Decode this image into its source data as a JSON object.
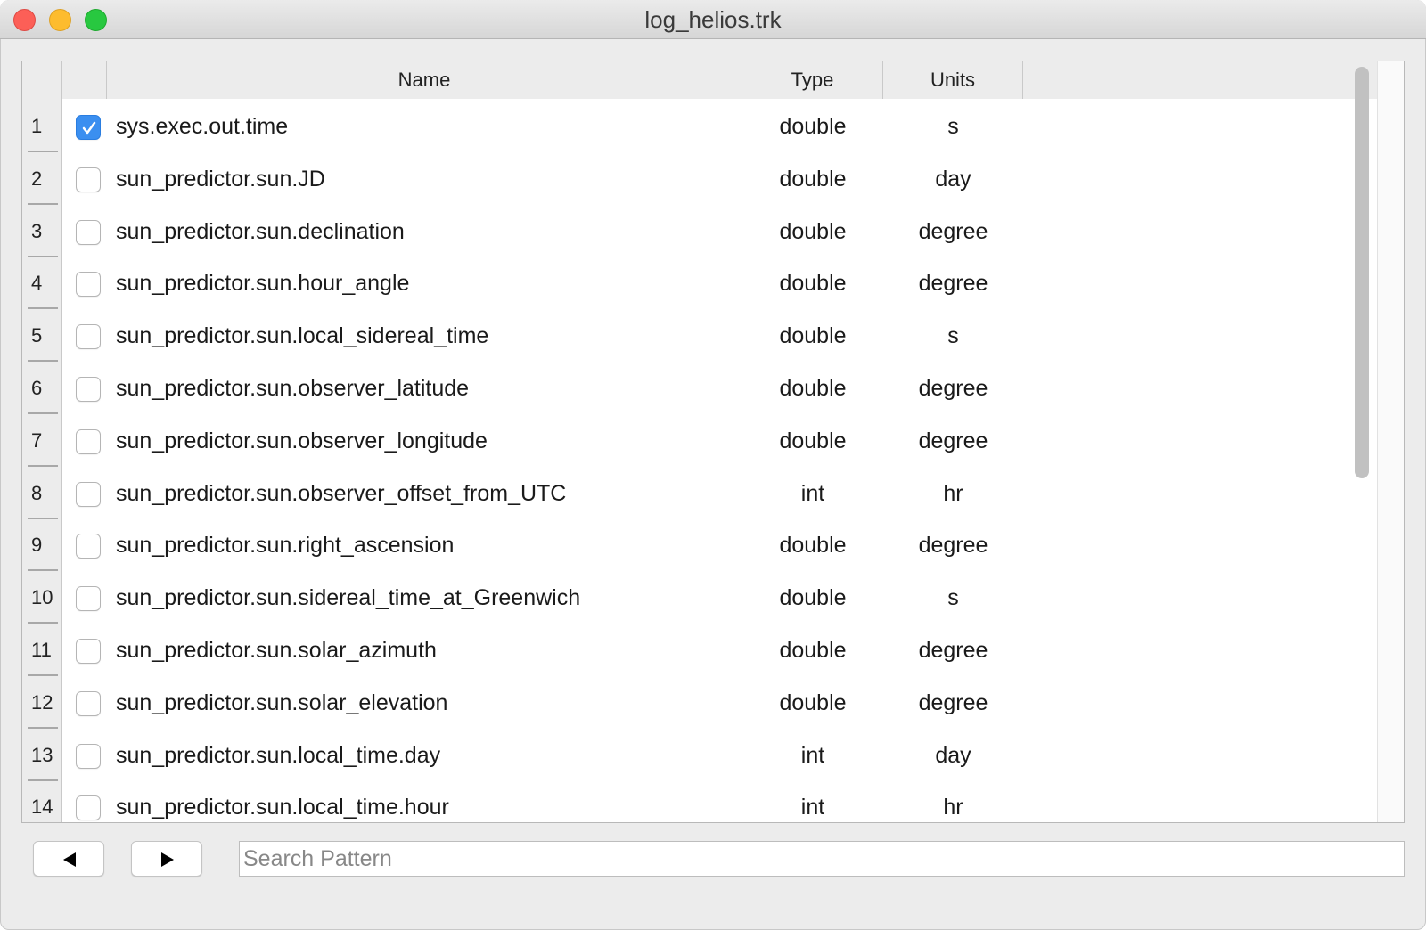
{
  "window": {
    "title": "log_helios.trk"
  },
  "table": {
    "columns": {
      "name": "Name",
      "type": "Type",
      "units": "Units"
    },
    "rows": [
      {
        "num": "1",
        "checked": true,
        "name": "sys.exec.out.time",
        "type": "double",
        "units": "s"
      },
      {
        "num": "2",
        "checked": false,
        "name": "sun_predictor.sun.JD",
        "type": "double",
        "units": "day"
      },
      {
        "num": "3",
        "checked": false,
        "name": "sun_predictor.sun.declination",
        "type": "double",
        "units": "degree"
      },
      {
        "num": "4",
        "checked": false,
        "name": "sun_predictor.sun.hour_angle",
        "type": "double",
        "units": "degree"
      },
      {
        "num": "5",
        "checked": false,
        "name": "sun_predictor.sun.local_sidereal_time",
        "type": "double",
        "units": "s"
      },
      {
        "num": "6",
        "checked": false,
        "name": "sun_predictor.sun.observer_latitude",
        "type": "double",
        "units": "degree"
      },
      {
        "num": "7",
        "checked": false,
        "name": "sun_predictor.sun.observer_longitude",
        "type": "double",
        "units": "degree"
      },
      {
        "num": "8",
        "checked": false,
        "name": "sun_predictor.sun.observer_offset_from_UTC",
        "type": "int",
        "units": "hr"
      },
      {
        "num": "9",
        "checked": false,
        "name": "sun_predictor.sun.right_ascension",
        "type": "double",
        "units": "degree"
      },
      {
        "num": "10",
        "checked": false,
        "name": "sun_predictor.sun.sidereal_time_at_Greenwich",
        "type": "double",
        "units": "s"
      },
      {
        "num": "11",
        "checked": false,
        "name": "sun_predictor.sun.solar_azimuth",
        "type": "double",
        "units": "degree"
      },
      {
        "num": "12",
        "checked": false,
        "name": "sun_predictor.sun.solar_elevation",
        "type": "double",
        "units": "degree"
      },
      {
        "num": "13",
        "checked": false,
        "name": "sun_predictor.sun.local_time.day",
        "type": "int",
        "units": "day"
      },
      {
        "num": "14",
        "checked": false,
        "name": "sun_predictor.sun.local_time.hour",
        "type": "int",
        "units": "hr"
      }
    ]
  },
  "toolbar": {
    "prev_icon": "left-triangle-icon",
    "next_icon": "right-triangle-icon"
  },
  "search": {
    "placeholder": "Search Pattern",
    "value": ""
  },
  "colors": {
    "checkbox_checked": "#3b8ff0"
  }
}
